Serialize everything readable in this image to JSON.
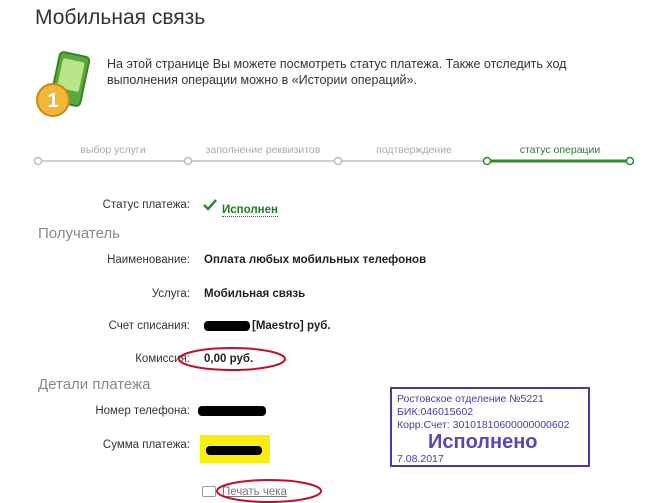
{
  "page": {
    "title": "Мобильная связь"
  },
  "intro": {
    "text": "На этой странице Вы можете посмотреть статус платежа. Также отследить ход выполнения операции можно в «Истории операций».",
    "icon": "mobile-payment-icon"
  },
  "steps": [
    {
      "label": "выбор услуги",
      "active": false
    },
    {
      "label": "заполнение реквизитов",
      "active": false
    },
    {
      "label": "подтверждение",
      "active": false
    },
    {
      "label": "статус операции",
      "active": true
    }
  ],
  "status": {
    "label": "Статус платежа:",
    "value": "Исполнен"
  },
  "recipient": {
    "heading": "Получатель",
    "name_label": "Наименование:",
    "name_value": "Оплата любых мобильных телефонов",
    "service_label": "Услуга:",
    "service_value": "Мобильная связь",
    "account_label": "Счет списания:",
    "account_value": "[Maestro]  руб.",
    "fee_label": "Комиссия:",
    "fee_value": "0,00 руб."
  },
  "details": {
    "heading": "Детали платежа",
    "phone_label": "Номер телефона:",
    "amount_label": "Сумма платежа:"
  },
  "stamp": {
    "line1": "Ростовское отделение №5221",
    "line2": "БИК:046015602",
    "line3": "Корр.Счет: 30101810600000000602",
    "big": "Исполнено",
    "date": "7.08.2017"
  },
  "print": {
    "label": "Печать чека"
  },
  "colors": {
    "accent_green": "#2b8a2e",
    "stamp": "#4a3aa0",
    "annotation_red": "#c0102a"
  }
}
